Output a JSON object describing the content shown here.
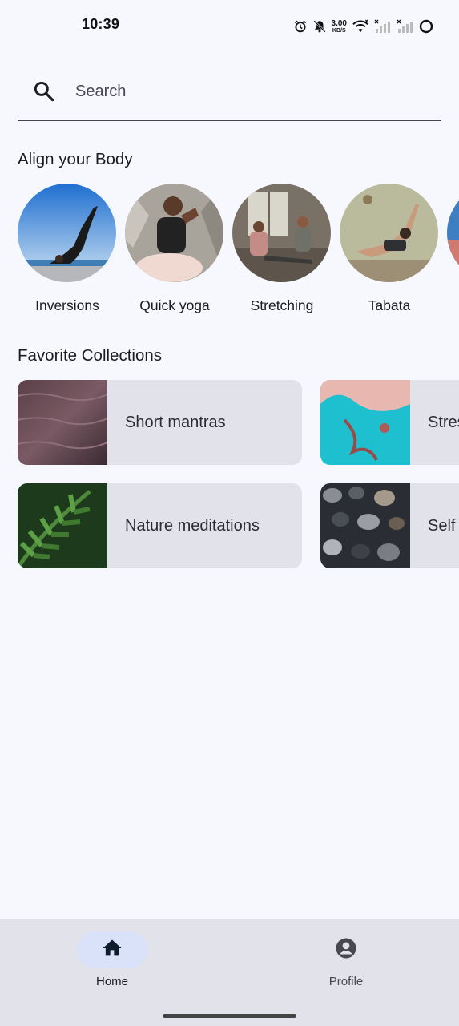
{
  "status_bar": {
    "time": "10:39",
    "net_speed_value": "3.00",
    "net_speed_unit": "KB/S",
    "icons": [
      "alarm-icon",
      "notifications-off-icon",
      "wifi-icon",
      "signal-no-service-icon",
      "signal-no-service-icon",
      "battery-ring-icon"
    ]
  },
  "search": {
    "placeholder": "Search",
    "icon": "search-icon"
  },
  "align_body": {
    "title": "Align your Body",
    "items": [
      {
        "label": "Inversions"
      },
      {
        "label": "Quick yoga"
      },
      {
        "label": "Stretching"
      },
      {
        "label": "Tabata"
      }
    ]
  },
  "favorite_collections": {
    "title": "Favorite Collections",
    "items": [
      {
        "label": "Short mantras"
      },
      {
        "label": "Stress and anxiety"
      },
      {
        "label": "Nature meditations"
      },
      {
        "label": "Self massage"
      }
    ]
  },
  "bottom_nav": {
    "items": [
      {
        "label": "Home",
        "icon": "home-icon",
        "active": true
      },
      {
        "label": "Profile",
        "icon": "account-circle-icon",
        "active": false
      }
    ]
  },
  "colors": {
    "background": "#f7f8fd",
    "card": "#e2e2ea",
    "nav_bar": "#e2e2ea",
    "active_indicator": "#d9e2f9",
    "text": "#1b1c20"
  }
}
